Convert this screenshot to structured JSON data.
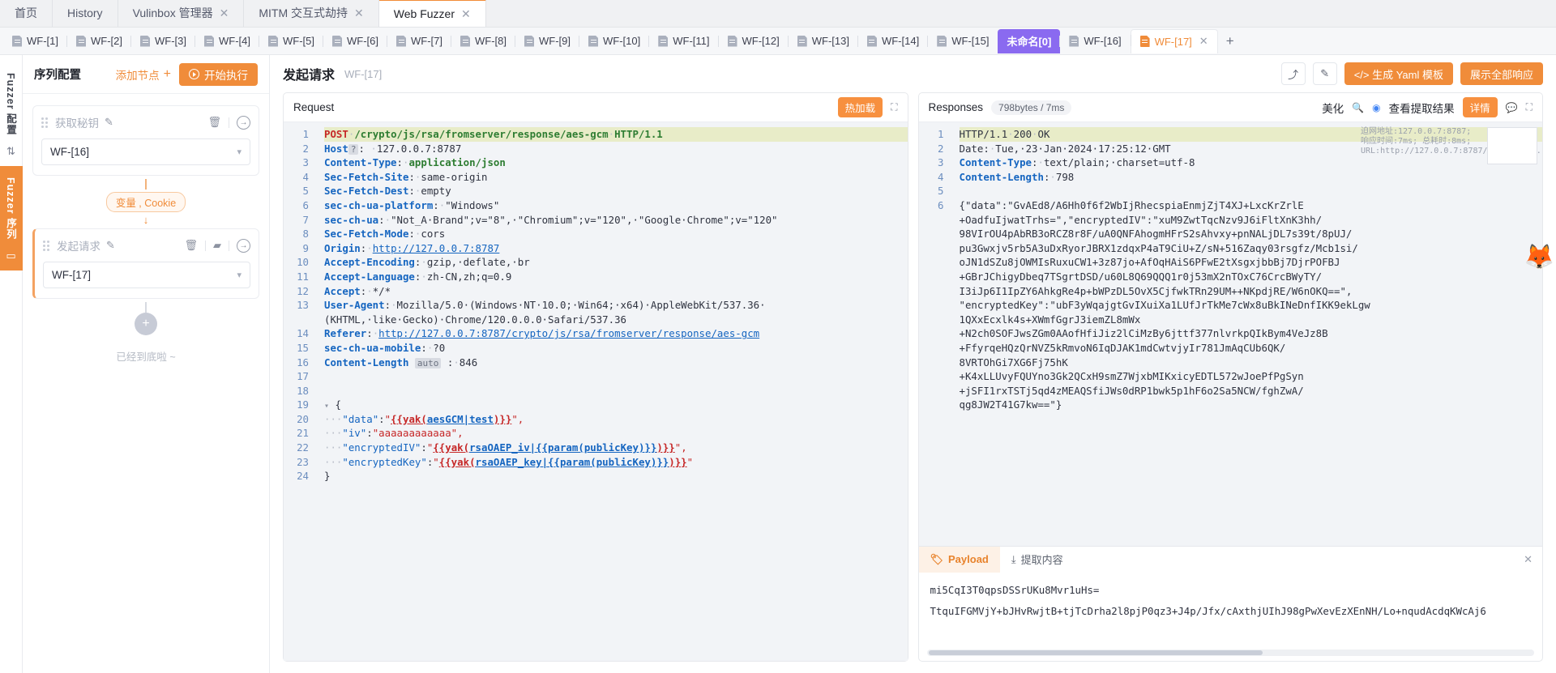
{
  "window_tabs": [
    {
      "label": "首页",
      "closable": false,
      "active": false
    },
    {
      "label": "History",
      "closable": false,
      "active": false
    },
    {
      "label": "Vulinbox 管理器",
      "closable": true,
      "active": false
    },
    {
      "label": "MITM 交互式劫持",
      "closable": true,
      "active": false
    },
    {
      "label": "Web Fuzzer",
      "closable": true,
      "active": true
    }
  ],
  "fuzzer_tabs": [
    {
      "label": "WF-[1]",
      "state": "normal"
    },
    {
      "label": "WF-[2]",
      "state": "normal"
    },
    {
      "label": "WF-[3]",
      "state": "normal"
    },
    {
      "label": "WF-[4]",
      "state": "normal"
    },
    {
      "label": "WF-[5]",
      "state": "normal"
    },
    {
      "label": "WF-[6]",
      "state": "normal"
    },
    {
      "label": "WF-[7]",
      "state": "normal"
    },
    {
      "label": "WF-[8]",
      "state": "normal"
    },
    {
      "label": "WF-[9]",
      "state": "normal"
    },
    {
      "label": "WF-[10]",
      "state": "normal"
    },
    {
      "label": "WF-[11]",
      "state": "normal"
    },
    {
      "label": "WF-[12]",
      "state": "normal"
    },
    {
      "label": "WF-[13]",
      "state": "normal"
    },
    {
      "label": "WF-[14]",
      "state": "normal"
    },
    {
      "label": "WF-[15]",
      "state": "normal"
    },
    {
      "label": "未命名[0]",
      "state": "purple"
    },
    {
      "label": "WF-[16]",
      "state": "normal"
    },
    {
      "label": "WF-[17]",
      "state": "orange"
    }
  ],
  "add_tab_label": "+",
  "rail": {
    "config_label": "Fuzzer 配置",
    "config_icon": "sliders-icon",
    "sequence_label": "Fuzzer 序列",
    "sequence_icon": "stack-icon"
  },
  "sequence": {
    "title": "序列配置",
    "add_node_label": "添加节点",
    "add_node_plus": "+",
    "run_label": "开始执行",
    "nodes": [
      {
        "name": "获取秘钥",
        "value": "WF-[16]",
        "selected": false
      },
      {
        "name": "发起请求",
        "value": "WF-[17]",
        "selected": true
      }
    ],
    "connector_label": "变量 , Cookie",
    "plus_node_label": "+",
    "end_text": "已经到底啦 ~"
  },
  "center": {
    "title": "发起请求",
    "subtitle": "WF-[17]",
    "share_icon": "share-icon",
    "edit_icon": "edit-square-icon",
    "yaml_button": "</> 生成 Yaml 模板",
    "show_all_button": "展示全部响应"
  },
  "request": {
    "pane_title": "Request",
    "hot_reload": "热加载",
    "expand_icon": "expand-icon",
    "lines": [
      {
        "n": 1,
        "hl": true,
        "html": "<span class=\"m\">POST</span><span class=\"dot\">·</span><span class=\"g\">/crypto/js/rsa/fromserver/response/aes-gcm</span><span class=\"dot\">·</span><span class=\"g\">HTTP/1.1</span>"
      },
      {
        "n": 2,
        "html": "<span class=\"k\">Host</span><span class=\"tag\">?</span>: <span class=\"dot\">·</span><span class=\"v\">127.0.0.7:8787</span>"
      },
      {
        "n": 3,
        "html": "<span class=\"k\">Content-Type</span>:<span class=\"dot\">·</span><span class=\"g\">application/json</span>"
      },
      {
        "n": 4,
        "html": "<span class=\"k\">Sec-Fetch-Site</span>:<span class=\"dot\">·</span><span class=\"v\">same-origin</span>"
      },
      {
        "n": 5,
        "html": "<span class=\"k\">Sec-Fetch-Dest</span>:<span class=\"dot\">·</span><span class=\"v\">empty</span>"
      },
      {
        "n": 6,
        "html": "<span class=\"k\">sec-ch-ua-platform</span>:<span class=\"dot\">·</span><span class=\"v\">\"Windows\"</span>"
      },
      {
        "n": 7,
        "html": "<span class=\"k\">sec-ch-ua</span>:<span class=\"dot\">·</span><span class=\"v\">\"Not_A·Brand\";v=\"8\",·\"Chromium\";v=\"120\",·\"Google·Chrome\";v=\"120\"</span>"
      },
      {
        "n": 8,
        "html": "<span class=\"k\">Sec-Fetch-Mode</span>:<span class=\"dot\">·</span><span class=\"v\">cors</span>"
      },
      {
        "n": 9,
        "html": "<span class=\"k\">Origin</span>:<span class=\"dot\">·</span><span class=\"u\">http://127.0.0.7:8787</span>"
      },
      {
        "n": 10,
        "html": "<span class=\"k\">Accept-Encoding</span>:<span class=\"dot\">·</span><span class=\"v\">gzip,·deflate,·br</span>"
      },
      {
        "n": 11,
        "html": "<span class=\"k\">Accept-Language</span>:<span class=\"dot\">·</span><span class=\"v\">zh-CN,zh;q=0.9</span>"
      },
      {
        "n": 12,
        "html": "<span class=\"k\">Accept</span>:<span class=\"dot\">·</span><span class=\"v\">*/*</span>"
      },
      {
        "n": 13,
        "html": "<span class=\"k\">User-Agent</span>:<span class=\"dot\">·</span><span class=\"v\">Mozilla/5.0·(Windows·NT·10.0;·Win64;·x64)·AppleWebKit/537.36·</span>"
      },
      {
        "n": null,
        "html": "<span class=\"v\">(KHTML,·like·Gecko)·Chrome/120.0.0.0·Safari/537.36</span>"
      },
      {
        "n": 14,
        "html": "<span class=\"k\">Referer</span>:<span class=\"dot\">·</span><span class=\"u\">http://127.0.0.7:8787/crypto/js/rsa/fromserver/response/aes-gcm</span>"
      },
      {
        "n": 15,
        "html": "<span class=\"k\">sec-ch-ua-mobile</span>:<span class=\"dot\">·</span><span class=\"v\">?0</span>"
      },
      {
        "n": 16,
        "html": "<span class=\"k\">Content-Length</span> <span class=\"tag\">auto</span> :<span class=\"dot\">·</span><span class=\"v\">846</span>"
      },
      {
        "n": 17,
        "html": ""
      },
      {
        "n": 18,
        "html": ""
      },
      {
        "n": 19,
        "html": "<span class=\"fold\">&#9662;</span> <span class=\"v\">{</span>"
      },
      {
        "n": 20,
        "html": "<span class=\"dot\">···</span><span class=\"blu\">\"data\"</span>:<span class=\"str\">\"</span><span class=\"yak\">{{yak(</span><span class=\"prm\">aesGCM|test</span><span class=\"yak\">)}}</span><span class=\"str\">\",</span>"
      },
      {
        "n": 21,
        "html": "<span class=\"dot\">···</span><span class=\"blu\">\"iv\"</span>:<span class=\"str\">\"aaaaaaaaaaaa\",</span>"
      },
      {
        "n": 22,
        "html": "<span class=\"dot\">···</span><span class=\"blu\">\"encryptedIV\"</span>:<span class=\"str\">\"</span><span class=\"yak\">{{yak(</span><span class=\"prm\">rsaOAEP_iv|{{param(publicKey)}}</span><span class=\"yak\">)}}</span><span class=\"str\">\",</span>"
      },
      {
        "n": 23,
        "html": "<span class=\"dot\">···</span><span class=\"blu\">\"encryptedKey\"</span>:<span class=\"str\">\"</span><span class=\"yak\">{{yak(</span><span class=\"prm\">rsaOAEP_key|{{param(publicKey)}}</span><span class=\"yak\">)}}</span><span class=\"str\">\"</span>"
      },
      {
        "n": 24,
        "html": "<span class=\"v\">}</span>"
      }
    ]
  },
  "responses": {
    "pane_title": "Responses",
    "size_time": "798bytes / 7ms",
    "beautify": "美化",
    "search_icon": "search-icon",
    "chrome_icon": "chrome-icon",
    "view_extract": "查看提取结果",
    "detail": "详情",
    "comment_icon": "comment-icon",
    "expand_icon": "expand-icon",
    "info_overlay": "迫网地址:127.0.0.7:8787; 响应时间:7ms; 总耗时:8ms; URL:http://127.0.0.7:8787/crypto/j...",
    "lines": [
      {
        "n": 1,
        "hl": true,
        "html": "<span class=\"v\">HTTP/1.1</span><span class=\"dot\">·</span><span class=\"v\">200</span><span class=\"dot\">·</span><span class=\"v\">OK</span>"
      },
      {
        "n": 2,
        "html": "<span class=\"v\">Date:</span><span class=\"dot\">·</span><span class=\"v\">Tue,·23·Jan·2024·17:25:12·GMT</span>"
      },
      {
        "n": 3,
        "html": "<span class=\"k\">Content-Type</span>:<span class=\"dot\">·</span><span class=\"v\">text/plain;·charset=utf-8</span>"
      },
      {
        "n": 4,
        "html": "<span class=\"k\">Content-Length</span>:<span class=\"dot\">·</span><span class=\"v\">798</span>"
      },
      {
        "n": 5,
        "html": ""
      },
      {
        "n": 6,
        "html": "<span class=\"v\">{\"data\":\"GvAEd8/A6Hh0f6f2WbIjRhecspiaEnmjZjT4XJ+LxcKrZrlE</span>"
      }
    ],
    "body_text": "{\"data\":\"GvAEd8/A6Hh0f6f2WbIjRhecspiaEnmjZjT4XJ+LxcKrZrlE\n+OadfuIjwatTrhs=\",\"encryptedIV\":\"xuM9ZwtTqcNzv9J6iFltXnK3hh/\n98VIrOU4pAbRB3oRCZ8r8F/uA0QNFAhogmHFrS2sAhvxy+pnNALjDL7s39t/8pUJ/\npu3Gwxjv5rb5A3uDxRyorJBRX1zdqxP4aT9CiU+Z/sN+516Zaqy03rsgfz/Mcb1si/\noJN1dSZu8jOWMIsRuxuCW1+3z87jo+AfOqHAiS6PFwE2tXsgxjbbBj7DjrPOFBJ\n+GBrJChigyDbeq7TSgrtDSD/u60L8Q69QQQ1r0j53mX2nTOxC76CrcBWyTY/\nI3iJp6I1IpZY6AhkgRe4p+bWPzDL5OvX5CjfwkTRn29UM++NKpdjRE/W6nOKQ==\",\n\"encryptedKey\":\"ubF3yWqajgtGvIXuiXa1LUfJrTkMe7cWx8uBkINeDnfIKK9ekLgw\n1QXxEcxlk4s+XWmfGgrJ3iemZL8mWx\n+N2ch0SOFJwsZGm0AAofHfiJiz2lCiMzBy6jttf377nlvrkpQIkBym4VeJz8B\n+FfyrqeHQzQrNVZ5kRmvoN6IqDJAK1mdCwtvjyIr781JmAqCUb6QK/\n8VRTOhGi7XG6Fj75hK\n+K4xLLUvyFQUYno3Gk2QCxH9smZ7WjxbMIKxicyEDTL572wJoePfPgSyn\n+jSFI1rxTSTj5qd4zMEAQSfiJWs0dRP1bwk5p1hF6o2Sa5NCW/fghZwA/\nqg8JW2T41G7kw==\"}"
  },
  "bottom": {
    "tabs": [
      {
        "label": "Payload",
        "icon": "tag-icon",
        "active": true
      },
      {
        "label": "提取内容",
        "icon": "download-icon",
        "active": false
      }
    ],
    "close_icon": "close-icon",
    "payload_lines": [
      "mi5CqI3T0qpsDSSrUKu8Mvr1uHs=",
      "TtquIFGMVjY+bJHvRwjtB+tjTcDrha2l8pjP0qz3+J4p/Jfx/cAxthjUIhJ98gPwXevEzXEnNH/Lo+nqudAcdqKWcAj6"
    ]
  }
}
